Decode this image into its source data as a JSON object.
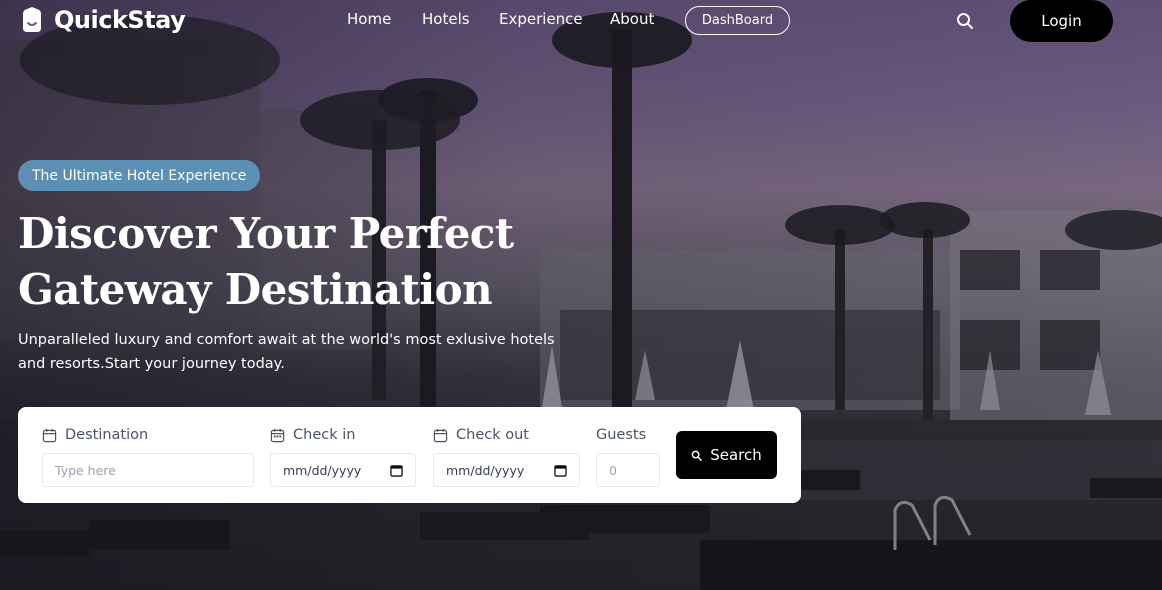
{
  "brand": {
    "name": "QuickStay"
  },
  "nav": {
    "links": [
      "Home",
      "Hotels",
      "Experience",
      "About"
    ],
    "dashboard_label": "DashBoard",
    "login_label": "Login"
  },
  "hero": {
    "badge": "The Ultimate Hotel Experience",
    "headline_line1": "Discover Your Perfect",
    "headline_line2": "Gateway Destination",
    "subline": "Unparalleled luxury and comfort await at the world's most exlusive hotels and resorts.Start your journey today."
  },
  "search": {
    "destination_label": "Destination",
    "destination_placeholder": "Type here",
    "checkin_label": "Check in",
    "checkin_value": "mm/dd/yyyy",
    "checkout_label": "Check out",
    "checkout_value": "mm/dd/yyyy",
    "guests_label": "Guests",
    "guests_placeholder": "0",
    "button_label": "Search"
  },
  "colors": {
    "badge_bg": "#5b8fb3",
    "button_bg": "#000000",
    "card_bg": "#ffffff"
  },
  "icons": [
    "home-logo-icon",
    "search-icon",
    "calendar-icon"
  ]
}
